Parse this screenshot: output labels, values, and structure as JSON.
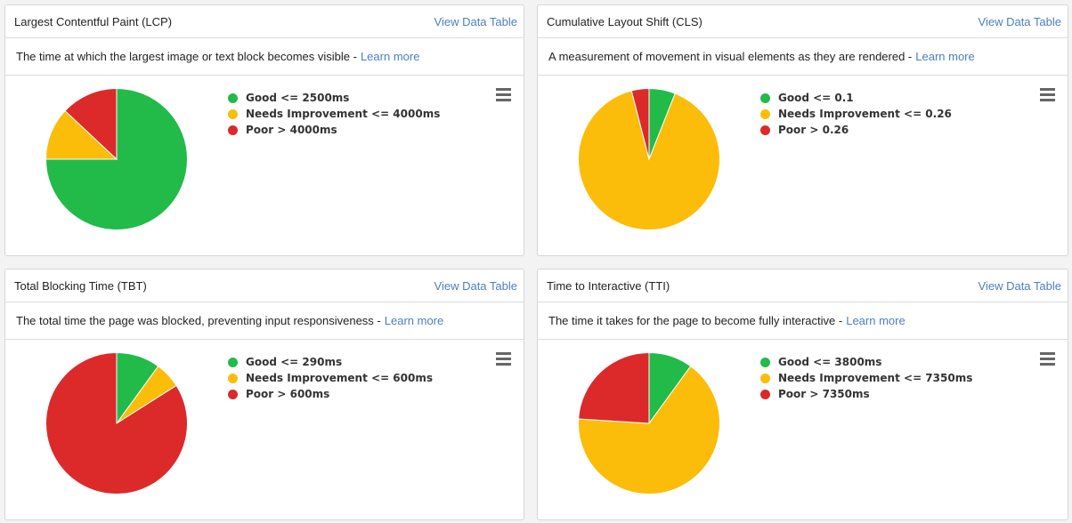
{
  "colors": {
    "good": "#22bb4a",
    "needs": "#fbbd0a",
    "poor": "#dc2a2a",
    "link": "#4a7fc1"
  },
  "common": {
    "view_table": "View Data Table",
    "learn_more": "Learn more"
  },
  "panels": [
    {
      "title": "Largest Contentful Paint (LCP)",
      "description": "The time at which the largest image or text block becomes visible -",
      "legend": [
        "Good <= 2500ms",
        "Needs Improvement <= 4000ms",
        "Poor > 4000ms"
      ]
    },
    {
      "title": "Cumulative Layout Shift (CLS)",
      "description": "A measurement of movement in visual elements as they are rendered -",
      "legend": [
        "Good <= 0.1",
        "Needs Improvement <= 0.26",
        "Poor > 0.26"
      ]
    },
    {
      "title": "Total Blocking Time (TBT)",
      "description": "The total time the page was blocked, preventing input responsiveness -",
      "legend": [
        "Good <= 290ms",
        "Needs Improvement <= 600ms",
        "Poor > 600ms"
      ]
    },
    {
      "title": "Time to Interactive (TTI)",
      "description": "The time it takes for the page to become fully interactive -",
      "legend": [
        "Good <= 3800ms",
        "Needs Improvement <= 7350ms",
        "Poor > 7350ms"
      ]
    }
  ],
  "chart_data": [
    {
      "type": "pie",
      "title": "Largest Contentful Paint (LCP)",
      "categories": [
        "Good <= 2500ms",
        "Needs Improvement <= 4000ms",
        "Poor > 4000ms"
      ],
      "values": [
        75,
        12,
        13
      ],
      "legend": "right"
    },
    {
      "type": "pie",
      "title": "Cumulative Layout Shift (CLS)",
      "categories": [
        "Good <= 0.1",
        "Needs Improvement <= 0.26",
        "Poor > 0.26"
      ],
      "values": [
        6,
        90,
        4
      ],
      "legend": "right"
    },
    {
      "type": "pie",
      "title": "Total Blocking Time (TBT)",
      "categories": [
        "Good <= 290ms",
        "Needs Improvement <= 600ms",
        "Poor > 600ms"
      ],
      "values": [
        10,
        6,
        84
      ],
      "legend": "right"
    },
    {
      "type": "pie",
      "title": "Time to Interactive (TTI)",
      "categories": [
        "Good <= 3800ms",
        "Needs Improvement <= 7350ms",
        "Poor > 7350ms"
      ],
      "values": [
        10,
        66,
        24
      ],
      "legend": "right"
    }
  ]
}
